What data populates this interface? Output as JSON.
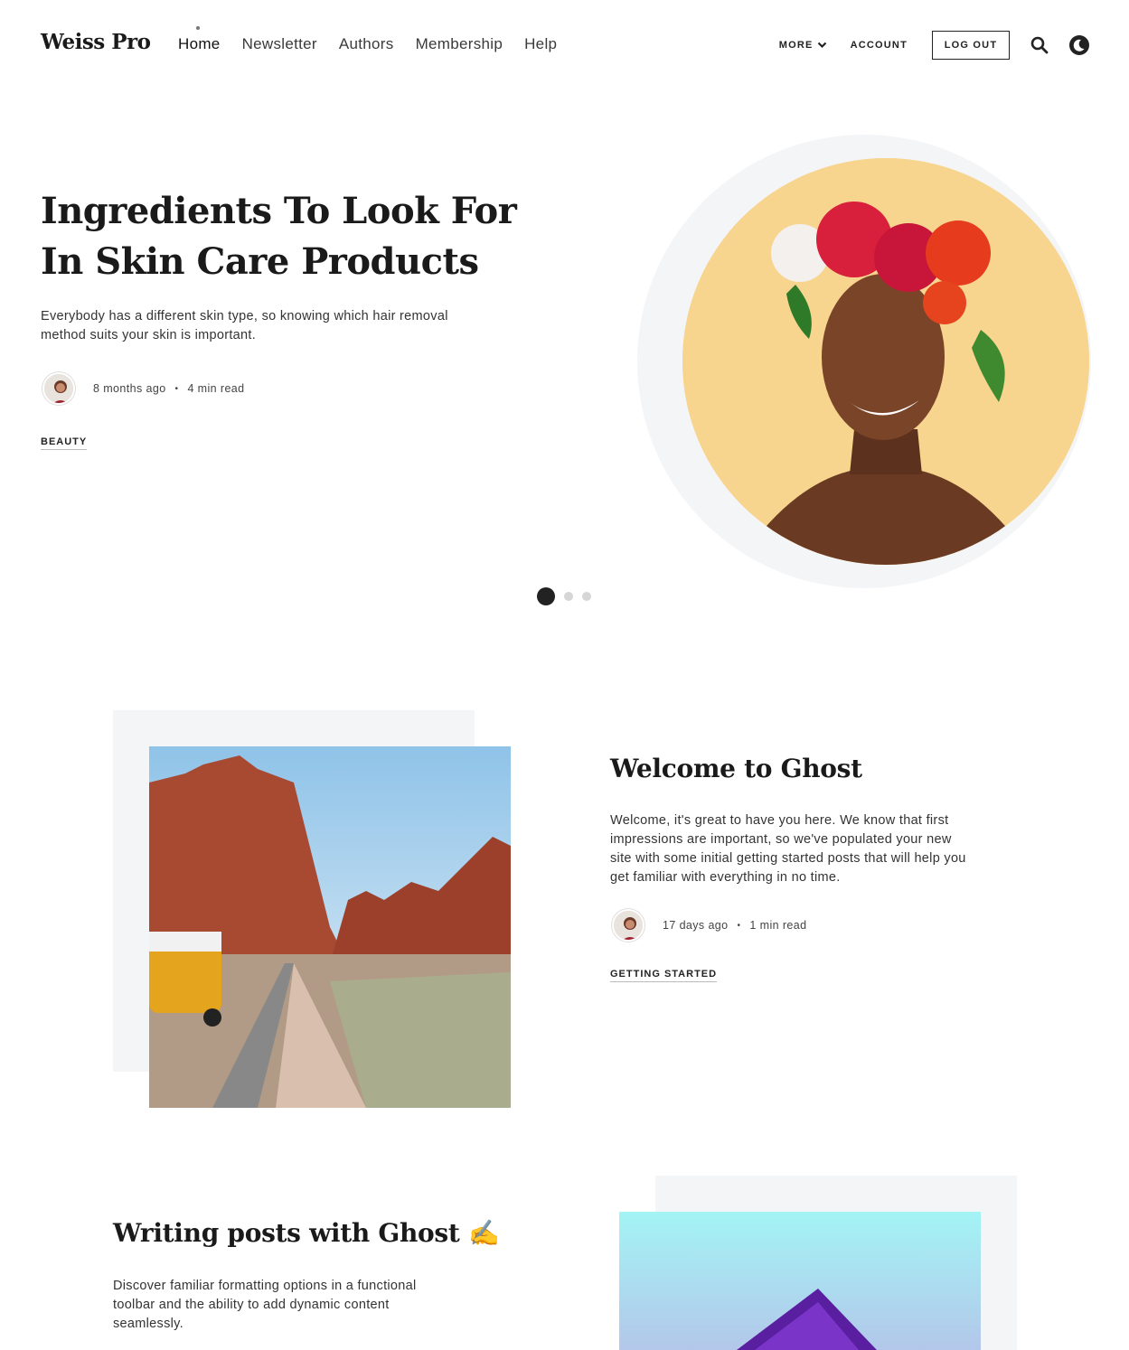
{
  "header": {
    "logo": "Weiss Pro",
    "nav": [
      "Home",
      "Newsletter",
      "Authors",
      "Membership",
      "Help"
    ],
    "more_label": "MORE",
    "account_label": "ACCOUNT",
    "logout_label": "LOG OUT"
  },
  "hero": {
    "title": "Ingredients To Look For In Skin Care Products",
    "excerpt": "Everybody has a different skin type, so knowing which hair removal method suits your skin is important.",
    "time": "8 months ago",
    "read": "4 min read",
    "tag": "BEAUTY",
    "pagination": {
      "total": 3,
      "active": 1
    }
  },
  "posts": [
    {
      "title": "Welcome to Ghost",
      "excerpt": "Welcome, it's great to have you here. We know that first impressions are important, so we've populated your new site with some initial getting started posts that will help you get familiar with everything in no time.",
      "time": "17 days ago",
      "read": "1 min read",
      "tag": "GETTING STARTED"
    },
    {
      "title": "Writing posts with Ghost ✍️",
      "excerpt": "Discover familiar formatting options in a functional toolbar and the ability to add dynamic content seamlessly."
    }
  ],
  "colors": {
    "accent": "#222222",
    "card_bg": "#f4f5f7",
    "hero_bg": "#f7d58e"
  },
  "icons": [
    "search-icon",
    "moon-icon",
    "chevron-down-icon"
  ]
}
